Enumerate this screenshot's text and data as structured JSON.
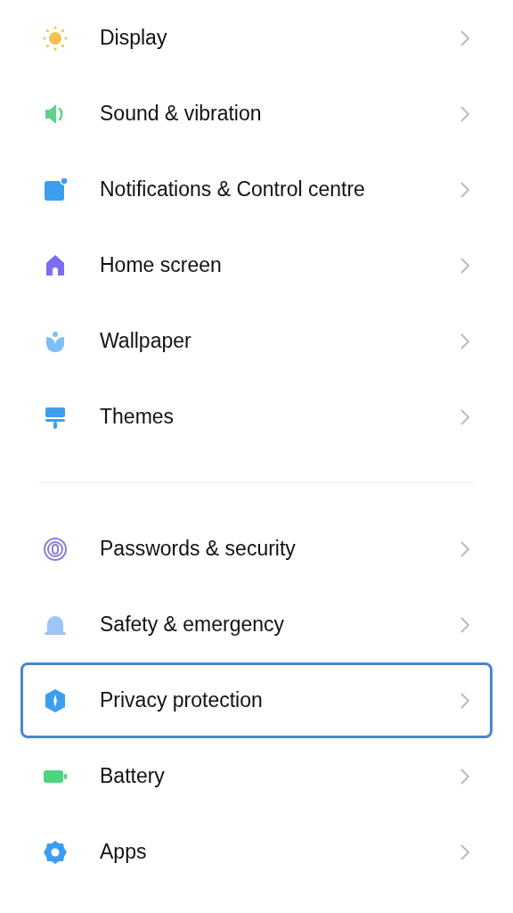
{
  "groups": [
    {
      "items": [
        {
          "kind": "sun",
          "label": "Display",
          "selected": false
        },
        {
          "kind": "speaker",
          "label": "Sound & vibration",
          "selected": false
        },
        {
          "kind": "notification",
          "label": "Notifications & Control centre",
          "selected": false
        },
        {
          "kind": "home",
          "label": "Home screen",
          "selected": false
        },
        {
          "kind": "flower",
          "label": "Wallpaper",
          "selected": false
        },
        {
          "kind": "brush",
          "label": "Themes",
          "selected": false
        }
      ]
    },
    {
      "items": [
        {
          "kind": "fingerprint",
          "label": "Passwords & security",
          "selected": false
        },
        {
          "kind": "alarm",
          "label": "Safety & emergency",
          "selected": false
        },
        {
          "kind": "shield",
          "label": "Privacy protection",
          "selected": true
        },
        {
          "kind": "battery",
          "label": "Battery",
          "selected": false
        },
        {
          "kind": "gear",
          "label": "Apps",
          "selected": false
        }
      ]
    }
  ]
}
